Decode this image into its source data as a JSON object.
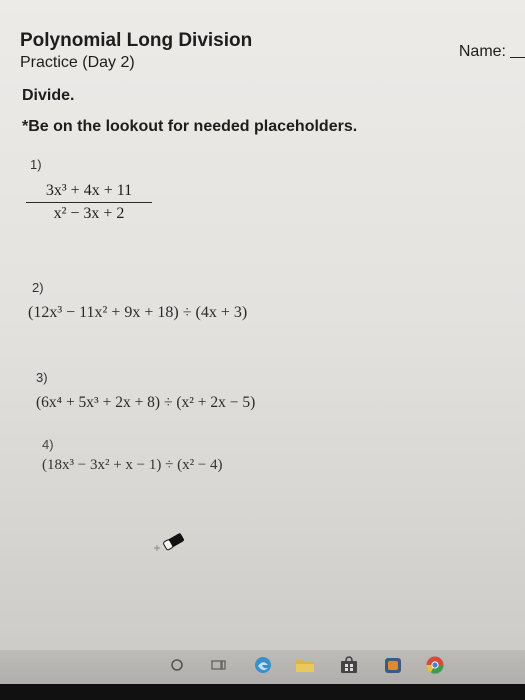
{
  "header": {
    "title": "Polynomial Long Division",
    "subtitle": "Practice (Day 2)",
    "name_label": "Name:"
  },
  "instructions": {
    "divide": "Divide.",
    "note": "*Be on the lookout for needed placeholders."
  },
  "problems": [
    {
      "number": "1)",
      "numerator": "3x³ + 4x + 11",
      "denominator": "x² − 3x + 2"
    },
    {
      "number": "2)",
      "expression": "(12x³ − 11x² + 9x + 18) ÷ (4x + 3)"
    },
    {
      "number": "3)",
      "expression": "(6x⁴ + 5x³ + 2x + 8) ÷ (x² + 2x − 5)"
    },
    {
      "number": "4)",
      "expression": "(18x³ − 3x² + x − 1) ÷ (x² − 4)"
    }
  ],
  "taskbar": {
    "icons": [
      "search-icon",
      "task-view-icon",
      "edge-icon",
      "file-explorer-icon",
      "store-icon",
      "app-icon",
      "chrome-icon"
    ]
  }
}
